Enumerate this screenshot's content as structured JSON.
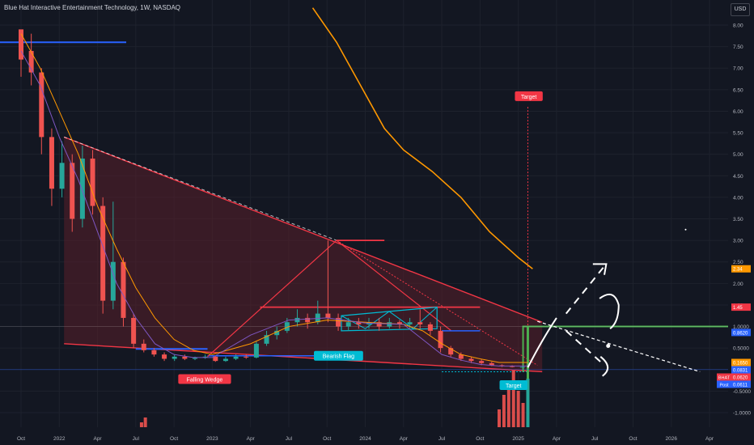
{
  "header": {
    "title": "Blue Hat Interactive Entertainment Technology, 1W, NASDAQ",
    "currency": "USD"
  },
  "colors": {
    "background": "#131722",
    "grid": "#1e222d",
    "up": "#26a69a",
    "down": "#ef5350",
    "wedge_fill": "#5a1f2a",
    "wedge_line": "#f23645",
    "blue_line": "#2962ff",
    "orange_ma": "#ff9800",
    "green_box": "#4caf50",
    "label_red": "#f23645",
    "label_teal": "#00bcd4",
    "ma_short": "#7e57c2",
    "drawing": "#ffffff"
  },
  "chart_data": {
    "type": "candlestick",
    "y_axis": {
      "ticks": [
        "8.00",
        "7.50",
        "7.00",
        "6.50",
        "6.00",
        "5.50",
        "5.00",
        "4.50",
        "4.00",
        "3.50",
        "3.00",
        "2.50",
        "2.00",
        "1.50",
        "1.0000",
        "0.5000",
        "0.0000",
        "-0.5000",
        "-1.0000"
      ],
      "tick_values": [
        8.0,
        7.5,
        7.0,
        6.5,
        6.0,
        5.5,
        5.0,
        4.5,
        4.0,
        3.5,
        3.0,
        2.5,
        2.0,
        1.5,
        1.0,
        0.5,
        0.0,
        -0.5,
        -1.0
      ],
      "ylim": [
        -1.3,
        8.4
      ]
    },
    "x_axis": {
      "ticks": [
        "Oct",
        "2022",
        "Apr",
        "Jul",
        "Oct",
        "2023",
        "Apr",
        "Jul",
        "Oct",
        "2024",
        "Apr",
        "Jul",
        "Oct",
        "2025",
        "Apr",
        "Jul",
        "Oct",
        "2026",
        "Apr"
      ],
      "tick_index": [
        0,
        4,
        8,
        12,
        16,
        20,
        24,
        28,
        32,
        36,
        40,
        44,
        48,
        52,
        56,
        60,
        64,
        68,
        72
      ]
    },
    "price_labels": [
      {
        "text": "2.34",
        "value": 2.34,
        "color": "#ff9800"
      },
      {
        "text": "1.45",
        "value": 1.45,
        "color": "#f23645"
      },
      {
        "text": "0.8620",
        "value": 0.862,
        "color": "#2962ff"
      },
      {
        "text": "0.1650",
        "value": 0.165,
        "color": "#ff9800"
      },
      {
        "text": "0.0831",
        "value": 0.0831,
        "color": "#2962ff"
      },
      {
        "text": "0.0620",
        "value": 0.062,
        "color": "#f23645",
        "tag": "BHAT"
      },
      {
        "text": "0.0611",
        "value": 0.0611,
        "color": "#2962ff",
        "tag": "Post"
      }
    ],
    "annotations": [
      {
        "text": "Falling Wedge",
        "x": 19.2,
        "y": -0.22,
        "color": "#f23645"
      },
      {
        "text": "Bearish Flag",
        "x": 33.2,
        "y": 0.32,
        "color": "#00bcd4"
      },
      {
        "text": "Target",
        "x": 53.1,
        "y": 6.35,
        "color": "#f23645"
      },
      {
        "text": "Target",
        "x": 51.5,
        "y": -0.36,
        "color": "#00bcd4"
      }
    ],
    "candles_quarterly_weeks": [
      [
        7.9,
        7.2,
        7.4,
        6.8
      ],
      [
        7.4,
        6.9,
        7.8,
        6.6
      ],
      [
        6.9,
        5.4,
        7.0,
        5.0
      ],
      [
        5.4,
        4.2,
        5.6,
        3.8
      ],
      [
        4.2,
        4.8,
        5.3,
        4.0
      ],
      [
        4.8,
        3.5,
        5.0,
        3.2
      ],
      [
        3.5,
        4.9,
        5.2,
        3.3
      ],
      [
        4.9,
        3.8,
        5.1,
        3.6
      ],
      [
        3.8,
        1.6,
        4.0,
        1.3
      ],
      [
        1.6,
        2.5,
        3.9,
        1.4
      ],
      [
        2.5,
        1.2,
        2.6,
        1.0
      ],
      [
        1.2,
        0.6,
        1.3,
        0.5
      ],
      [
        0.6,
        0.45,
        0.7,
        0.4
      ],
      [
        0.45,
        0.35,
        0.5,
        0.3
      ],
      [
        0.35,
        0.25,
        0.4,
        0.2
      ],
      [
        0.25,
        0.3,
        0.35,
        0.2
      ],
      [
        0.3,
        0.25,
        0.35,
        0.22
      ],
      [
        0.25,
        0.28,
        0.3,
        0.22
      ],
      [
        0.28,
        0.3,
        0.35,
        0.25
      ],
      [
        0.3,
        0.2,
        0.32,
        0.18
      ],
      [
        0.2,
        0.25,
        0.3,
        0.18
      ],
      [
        0.25,
        0.3,
        0.35,
        0.22
      ],
      [
        0.3,
        0.28,
        0.35,
        0.25
      ],
      [
        0.28,
        0.6,
        0.65,
        0.26
      ],
      [
        0.6,
        0.8,
        0.9,
        0.55
      ],
      [
        0.8,
        0.9,
        1.0,
        0.7
      ],
      [
        0.9,
        1.1,
        1.2,
        0.85
      ],
      [
        1.1,
        1.2,
        1.4,
        1.0
      ],
      [
        1.2,
        1.1,
        1.3,
        0.95
      ],
      [
        1.1,
        1.3,
        1.6,
        1.05
      ],
      [
        1.3,
        1.2,
        3.0,
        1.1
      ],
      [
        1.2,
        1.0,
        1.3,
        0.9
      ],
      [
        1.0,
        1.1,
        1.2,
        0.9
      ],
      [
        1.1,
        1.05,
        1.2,
        0.95
      ],
      [
        1.05,
        1.1,
        1.2,
        0.95
      ],
      [
        1.1,
        1.0,
        1.2,
        0.9
      ],
      [
        1.0,
        1.1,
        1.2,
        0.95
      ],
      [
        1.1,
        1.05,
        1.15,
        0.95
      ],
      [
        1.05,
        1.1,
        1.2,
        0.95
      ],
      [
        1.1,
        1.05,
        1.4,
        0.95
      ],
      [
        1.05,
        0.9,
        1.1,
        0.8
      ],
      [
        0.9,
        0.5,
        1.0,
        0.4
      ],
      [
        0.5,
        0.35,
        0.55,
        0.3
      ],
      [
        0.35,
        0.25,
        0.4,
        0.2
      ],
      [
        0.25,
        0.2,
        0.3,
        0.15
      ],
      [
        0.2,
        0.15,
        0.25,
        0.1
      ],
      [
        0.15,
        0.1,
        0.18,
        0.08
      ],
      [
        0.1,
        0.08,
        0.12,
        0.06
      ],
      [
        0.08,
        0.062,
        0.1,
        0.05
      ],
      [
        0.062,
        0.062,
        0.07,
        0.05
      ]
    ]
  }
}
